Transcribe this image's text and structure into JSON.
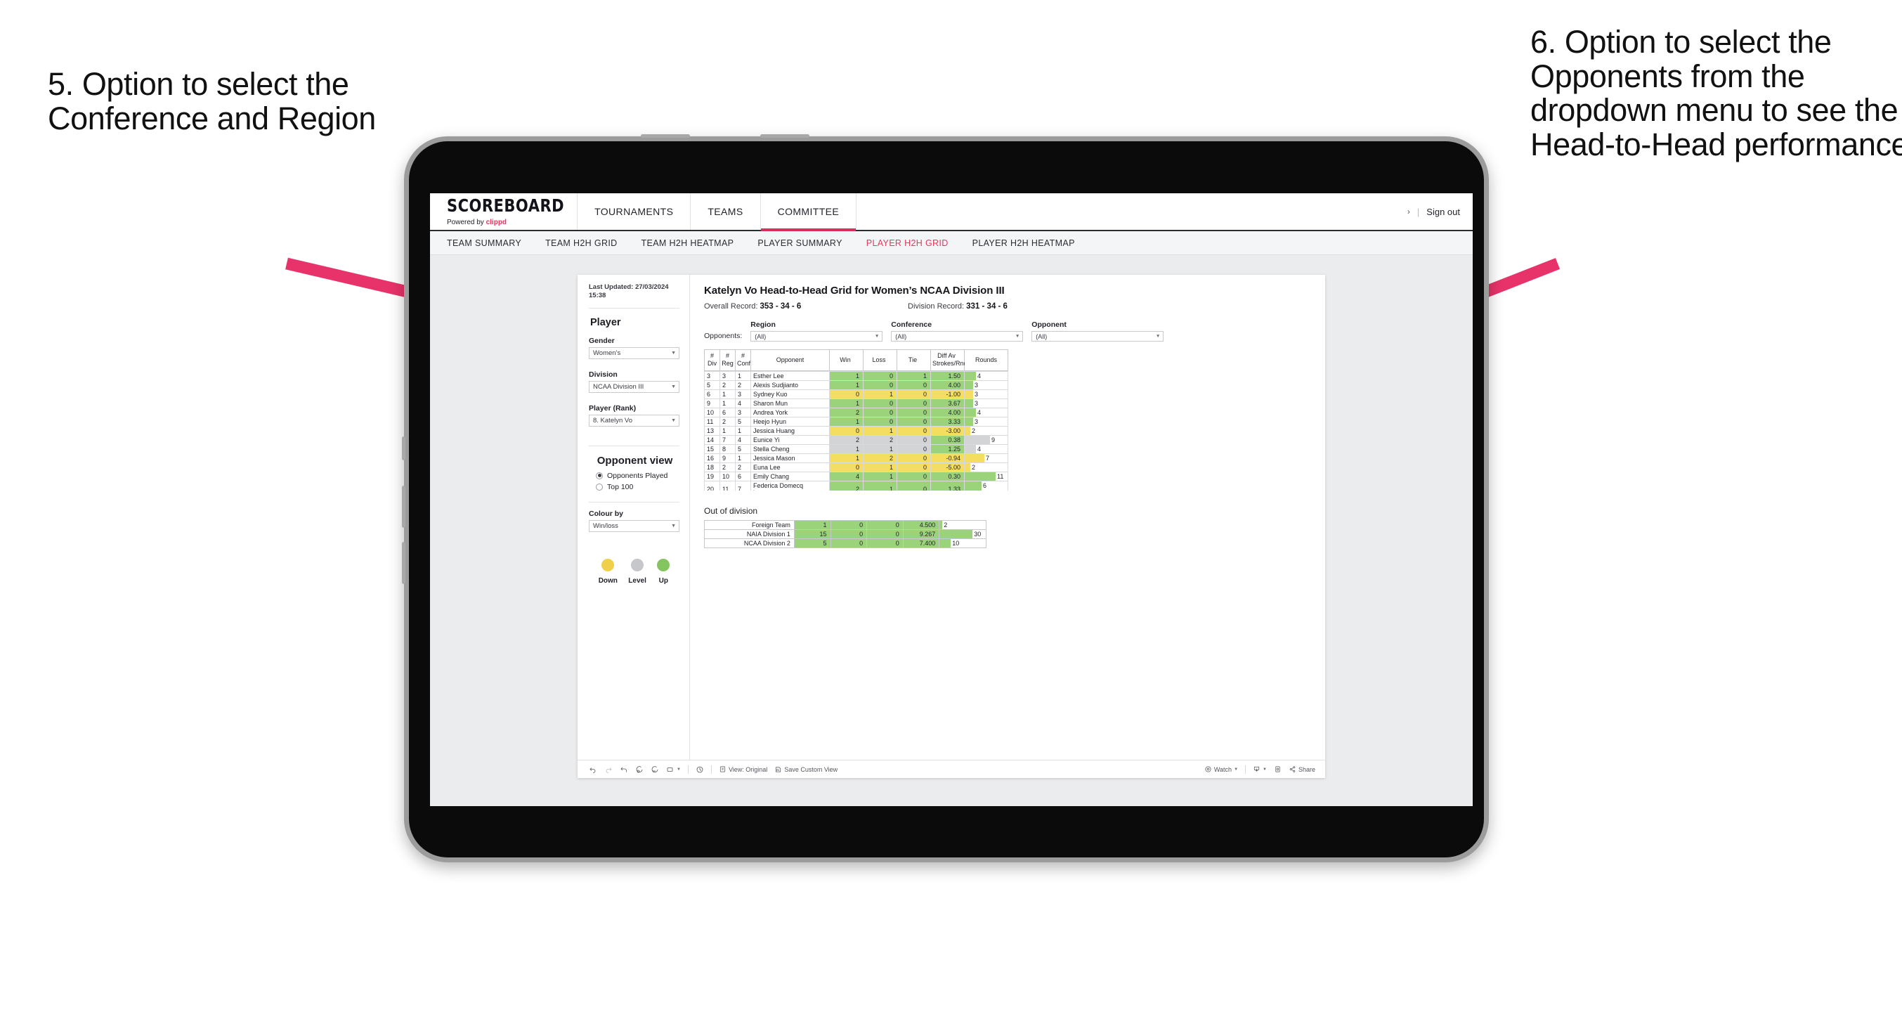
{
  "annotations": {
    "left": "5. Option to select the Conference and Region",
    "right": "6. Option to select the Opponents from the dropdown menu to see the Head-to-Head performance",
    "arrow_color": "#e8336a"
  },
  "app": {
    "brand": {
      "name": "SCOREBOARD",
      "powered_prefix": "Powered by ",
      "powered_brand": "clippd"
    },
    "topnav": [
      {
        "label": "TOURNAMENTS",
        "active": false
      },
      {
        "label": "TEAMS",
        "active": false
      },
      {
        "label": "COMMITTEE",
        "active": true
      }
    ],
    "header_right": {
      "chevron": "›",
      "separator": "|",
      "sign_out": "Sign out"
    },
    "subnav": [
      {
        "label": "TEAM SUMMARY",
        "active": false
      },
      {
        "label": "TEAM H2H GRID",
        "active": false
      },
      {
        "label": "TEAM H2H HEATMAP",
        "active": false
      },
      {
        "label": "PLAYER SUMMARY",
        "active": false
      },
      {
        "label": "PLAYER H2H GRID",
        "active": true
      },
      {
        "label": "PLAYER H2H HEATMAP",
        "active": false
      }
    ],
    "accent_color": "#e8365d"
  },
  "sidebar": {
    "last_updated": "Last Updated: 27/03/2024\n15:38",
    "player_section_title": "Player",
    "fields": [
      {
        "label": "Gender",
        "value": "Women’s"
      },
      {
        "label": "Division",
        "value": "NCAA Division III"
      },
      {
        "label": "Player (Rank)",
        "value": "8. Katelyn Vo"
      }
    ],
    "opponent_view": {
      "title": "Opponent view",
      "options": [
        {
          "label": "Opponents Played",
          "selected": true
        },
        {
          "label": "Top 100",
          "selected": false
        }
      ]
    },
    "colour_by": {
      "label": "Colour by",
      "value": "Win/loss"
    },
    "legend": [
      {
        "label": "Down",
        "color": "#f0d04b"
      },
      {
        "label": "Level",
        "color": "#c6c7ca"
      },
      {
        "label": "Up",
        "color": "#84c561"
      }
    ]
  },
  "main": {
    "title": "Katelyn Vo Head-to-Head Grid for Women’s NCAA Division III",
    "overall_record_label": "Overall Record: ",
    "overall_record_value": "353 -  34 - 6",
    "division_record_label": "Division Record: ",
    "division_record_value": "331 -  34 - 6",
    "filters": {
      "row_label": "Opponents:",
      "items": [
        {
          "label": "Region",
          "value": "(All)"
        },
        {
          "label": "Conference",
          "value": "(All)"
        },
        {
          "label": "Opponent",
          "value": "(All)"
        }
      ]
    },
    "out_of_division_title": "Out of division"
  },
  "chart_data": {
    "type": "table",
    "title": "Katelyn Vo Head-to-Head Grid for Women’s NCAA Division III",
    "columns": [
      "# Div",
      "# Reg",
      "# Conf",
      "Opponent",
      "Win",
      "Loss",
      "Tie",
      "Diff Av Strokes/Rnd",
      "Rounds"
    ],
    "column_headers_multiline": [
      {
        "l1": "#",
        "l2": "Div"
      },
      {
        "l1": "#",
        "l2": "Reg"
      },
      {
        "l1": "#",
        "l2": "Conf"
      },
      {
        "l1": "Opponent",
        "l2": ""
      },
      {
        "l1": "Win",
        "l2": ""
      },
      {
        "l1": "Loss",
        "l2": ""
      },
      {
        "l1": "Tie",
        "l2": ""
      },
      {
        "l1": "Diff Av",
        "l2": "Strokes/Rnd"
      },
      {
        "l1": "Rounds",
        "l2": ""
      }
    ],
    "rounds_max": 12,
    "rows": [
      {
        "div": "3",
        "reg": "3",
        "conf": "1",
        "opponent": "Esther Lee",
        "win": "1",
        "loss": "0",
        "tie": "1",
        "diff": "1.50",
        "rounds": 4,
        "fill": "green"
      },
      {
        "div": "5",
        "reg": "2",
        "conf": "2",
        "opponent": "Alexis Sudjianto",
        "win": "1",
        "loss": "0",
        "tie": "0",
        "diff": "4.00",
        "rounds": 3,
        "fill": "green"
      },
      {
        "div": "6",
        "reg": "1",
        "conf": "3",
        "opponent": "Sydney Kuo",
        "win": "0",
        "loss": "1",
        "tie": "0",
        "diff": "-1.00",
        "rounds": 3,
        "fill": "yellow"
      },
      {
        "div": "9",
        "reg": "1",
        "conf": "4",
        "opponent": "Sharon Mun",
        "win": "1",
        "loss": "0",
        "tie": "0",
        "diff": "3.67",
        "rounds": 3,
        "fill": "green"
      },
      {
        "div": "10",
        "reg": "6",
        "conf": "3",
        "opponent": "Andrea York",
        "win": "2",
        "loss": "0",
        "tie": "0",
        "diff": "4.00",
        "rounds": 4,
        "fill": "green"
      },
      {
        "div": "11",
        "reg": "2",
        "conf": "5",
        "opponent": "Heejo Hyun",
        "win": "1",
        "loss": "0",
        "tie": "0",
        "diff": "3.33",
        "rounds": 3,
        "fill": "green"
      },
      {
        "div": "13",
        "reg": "1",
        "conf": "1",
        "opponent": "Jessica Huang",
        "win": "0",
        "loss": "1",
        "tie": "0",
        "diff": "-3.00",
        "rounds": 2,
        "fill": "yellow"
      },
      {
        "div": "14",
        "reg": "7",
        "conf": "4",
        "opponent": "Eunice Yi",
        "win": "2",
        "loss": "2",
        "tie": "0",
        "diff": "0.38",
        "rounds": 9,
        "fill": "grey",
        "diff_fill": "green"
      },
      {
        "div": "15",
        "reg": "8",
        "conf": "5",
        "opponent": "Stella Cheng",
        "win": "1",
        "loss": "1",
        "tie": "0",
        "diff": "1.25",
        "rounds": 4,
        "fill": "grey",
        "diff_fill": "green"
      },
      {
        "div": "16",
        "reg": "9",
        "conf": "1",
        "opponent": "Jessica Mason",
        "win": "1",
        "loss": "2",
        "tie": "0",
        "diff": "-0.94",
        "rounds": 7,
        "fill": "yellow"
      },
      {
        "div": "18",
        "reg": "2",
        "conf": "2",
        "opponent": "Euna Lee",
        "win": "0",
        "loss": "1",
        "tie": "0",
        "diff": "-5.00",
        "rounds": 2,
        "fill": "yellow"
      },
      {
        "div": "19",
        "reg": "10",
        "conf": "6",
        "opponent": "Emily Chang",
        "win": "4",
        "loss": "1",
        "tie": "0",
        "diff": "0.30",
        "rounds": 11,
        "fill": "green"
      },
      {
        "div": "20",
        "reg": "11",
        "conf": "7",
        "opponent": "Federica Domecq Lacroze",
        "win": "2",
        "loss": "1",
        "tie": "0",
        "diff": "1.33",
        "rounds": 6,
        "fill": "green"
      }
    ],
    "out_of_division": {
      "title": "Out of division",
      "rounds_max": 32,
      "rows": [
        {
          "name": "Foreign Team",
          "win": "1",
          "loss": "0",
          "tie": "0",
          "diff": "4.500",
          "rounds": 2,
          "fill": "green"
        },
        {
          "name": "NAIA Division 1",
          "win": "15",
          "loss": "0",
          "tie": "0",
          "diff": "9.267",
          "rounds": 30,
          "fill": "green"
        },
        {
          "name": "NCAA Division 2",
          "win": "5",
          "loss": "0",
          "tie": "0",
          "diff": "7.400",
          "rounds": 10,
          "fill": "green"
        }
      ]
    }
  },
  "toolbar": {
    "items": [
      {
        "name": "undo-icon",
        "label": ""
      },
      {
        "name": "redo-icon",
        "label": ""
      },
      {
        "name": "revert-icon",
        "label": ""
      },
      {
        "name": "refresh-icon",
        "label": ""
      },
      {
        "name": "pause-icon",
        "label": ""
      },
      {
        "name": "device-layout-icon",
        "label": ""
      }
    ],
    "view_original": "View: Original",
    "save_custom_view": "Save Custom View",
    "watch": "Watch",
    "share": "Share"
  }
}
